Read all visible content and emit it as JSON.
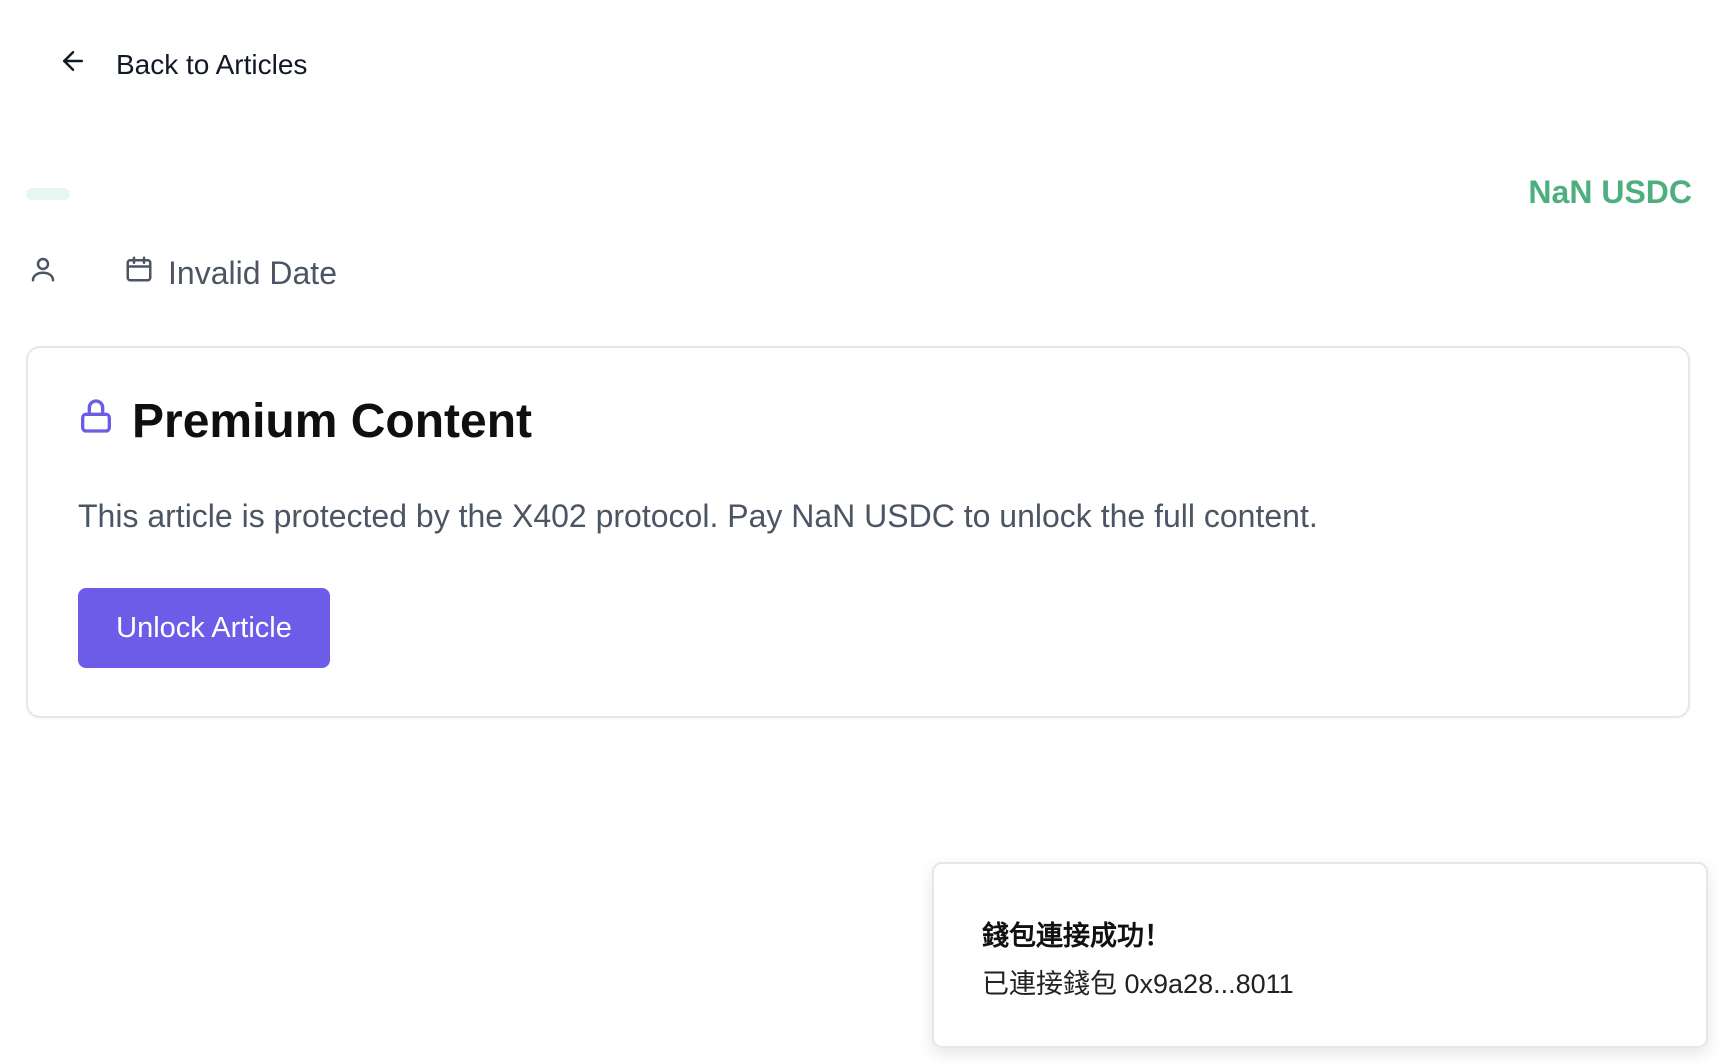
{
  "nav": {
    "back_label": "Back to Articles",
    "back_icon": "arrow-left-icon"
  },
  "article": {
    "price": "NaN USDC",
    "price_color": "#4caf7d",
    "date": "Invalid Date",
    "author_icon": "user-icon",
    "date_icon": "calendar-icon"
  },
  "paywall": {
    "title": "Premium Content",
    "title_icon": "lock-icon",
    "description": "This article is protected by the X402 protocol. Pay NaN USDC to unlock the full content.",
    "button_label": "Unlock Article",
    "accent_color": "#6c5ce7"
  },
  "toast": {
    "title": "錢包連接成功！",
    "description": "已連接錢包 0x9a28...8011"
  }
}
